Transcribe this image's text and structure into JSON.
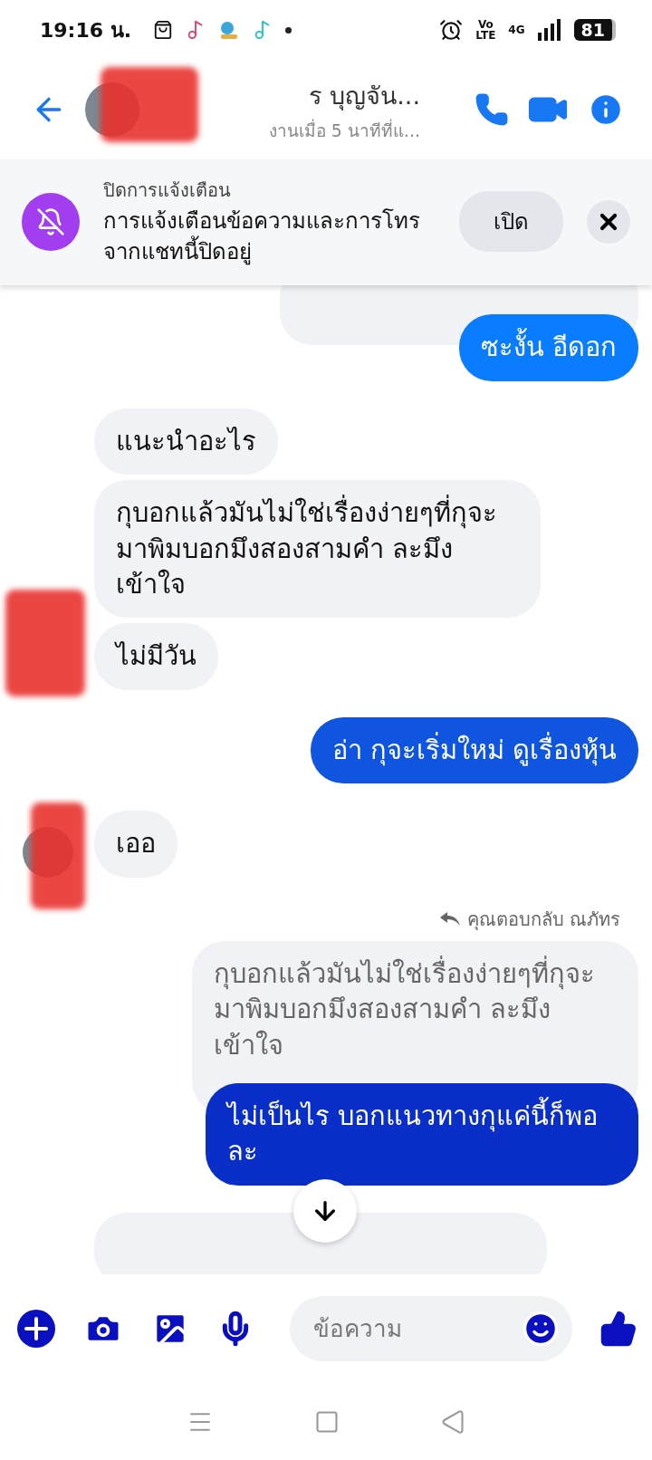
{
  "status_bar": {
    "time": "19:16 น.",
    "volte_top": "Vo",
    "volte_bottom": "LTE",
    "network": "4G",
    "battery": "81"
  },
  "header": {
    "name": "ร บุญจัน...",
    "status": "งานเมื่อ 5 นาทีที่แ..."
  },
  "banner": {
    "title": "ปิดการแจ้งเตือน",
    "message": "การแจ้งเตือนข้อความและการโทรจากแชทนี้ปิดอยู่",
    "button": "เปิด"
  },
  "messages": [
    {
      "kind": "quoted_cut"
    },
    {
      "kind": "sent",
      "text": "ซะงั้น อีดอก",
      "color": "#0a7cff"
    },
    {
      "kind": "received",
      "text": "แนะนำอะไร",
      "avatar": false
    },
    {
      "kind": "received",
      "text": "กุบอกแล้วมันไม่ใช่เรื่องง่ายๆที่กุจะมาพิมบอกมึงสองสามคำ ละมึงเข้าใจ",
      "avatar": false
    },
    {
      "kind": "received",
      "text": "ไม่มีวัน",
      "avatar": false
    },
    {
      "kind": "sent",
      "text": "อ่า กุจะเริ่มใหม่ ดูเรื่องหุ้น",
      "color": "#0f55e0"
    },
    {
      "kind": "received",
      "text": "เออ",
      "avatar": true
    },
    {
      "kind": "reply_label",
      "text": "คุณตอบกลับ ณภัทร"
    },
    {
      "kind": "quoted",
      "text": "กุบอกแล้วมันไม่ใช่เรื่องง่ายๆที่กุจะมาพิมบอกมึงสองสามคำ ละมึงเข้าใจ"
    },
    {
      "kind": "sent",
      "text": "ไม่เป็นไร บอกแนวทางกุแค่นี้ก็พอละ",
      "color": "#0a2fc8"
    },
    {
      "kind": "received_cut"
    }
  ],
  "composer": {
    "placeholder": "ข้อความ"
  }
}
